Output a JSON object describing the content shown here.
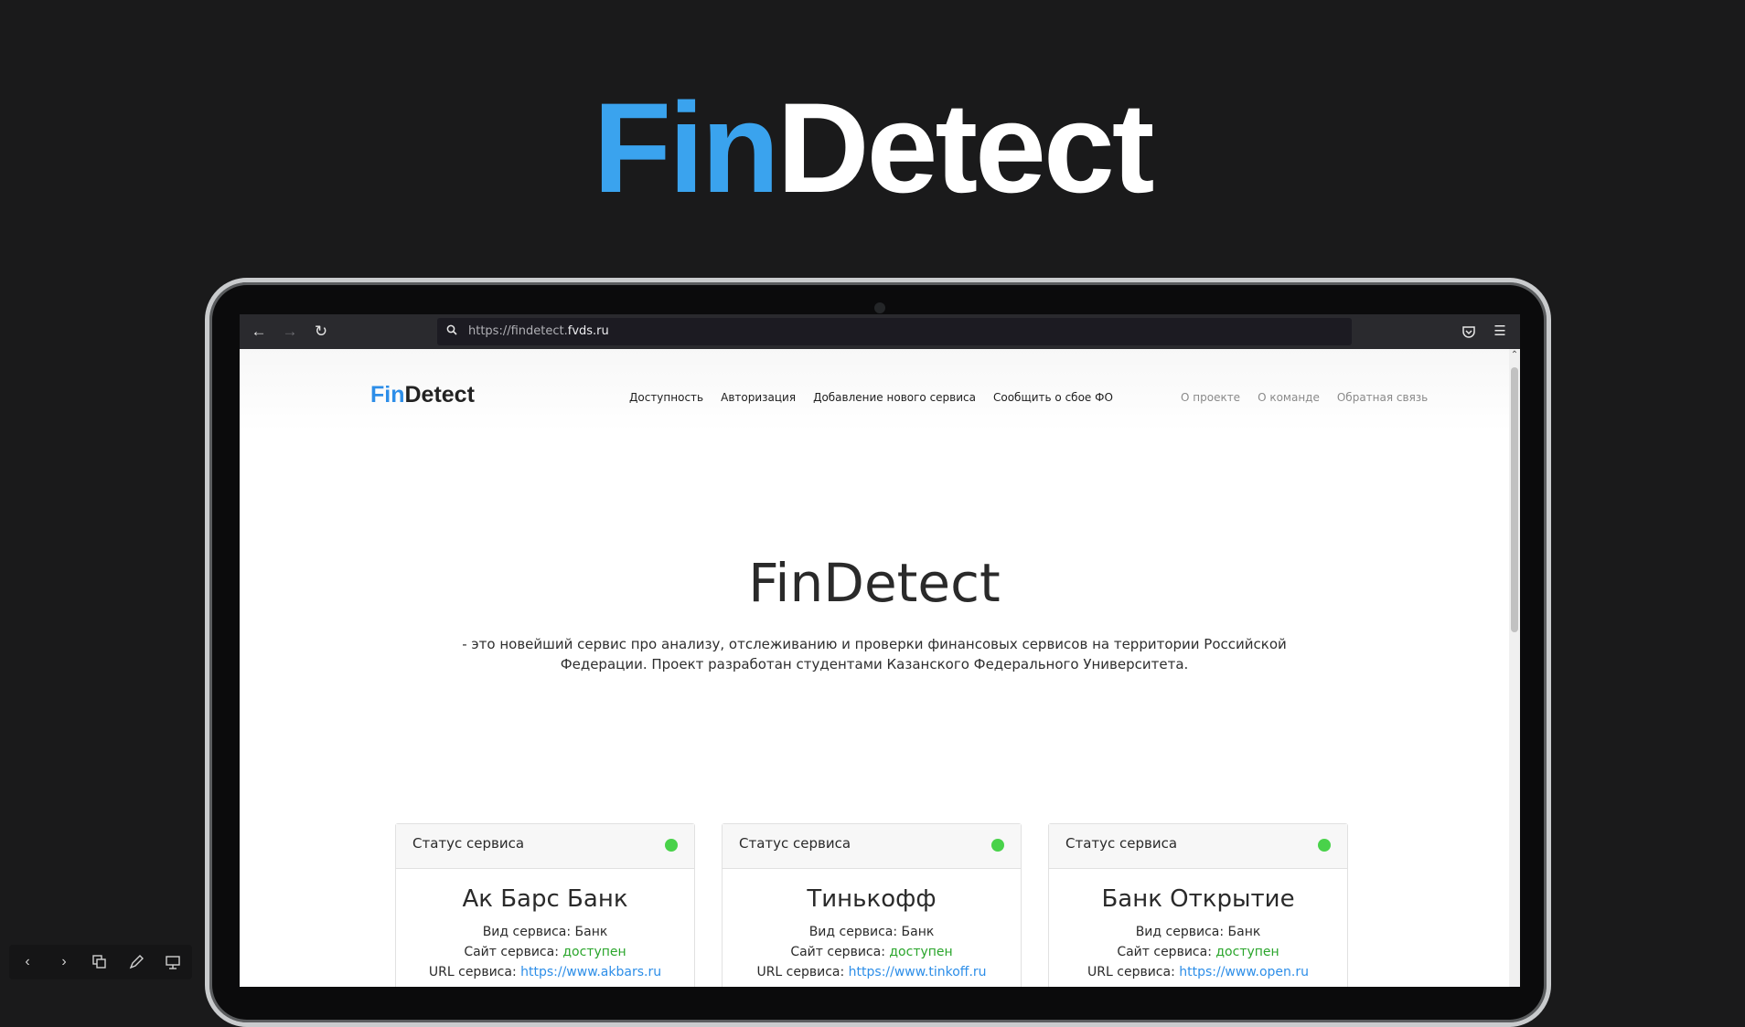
{
  "slide": {
    "title_fin": "Fin",
    "title_detect": "Detect"
  },
  "browser": {
    "url_prefix": "https://findetect.",
    "url_domain": "fvds.ru"
  },
  "site": {
    "logo_fin": "Fin",
    "logo_detect": "Detect",
    "main_nav": [
      "Доступность",
      "Авторизация",
      "Добавление нового сервиса",
      "Сообщить о сбое ФО"
    ],
    "side_nav": [
      "О проекте",
      "О команде",
      "Обратная связь"
    ],
    "hero_title": "FinDetect",
    "hero_description": "- это новейший сервис про анализу, отслеживанию и проверки финансовых сервисов на территории Российской Федерации. Проект разработан студентами Казанского Федерального Университета."
  },
  "cards": [
    {
      "status_label": "Статус сервиса",
      "name": "Ак Барс Банк",
      "type_label": "Вид сервиса:",
      "type_value": "Банк",
      "site_label": "Сайт сервиса:",
      "site_value": "доступен",
      "url_label": "URL сервиса:",
      "url_value": "https://www.akbars.ru"
    },
    {
      "status_label": "Статус сервиса",
      "name": "Тинькофф",
      "type_label": "Вид сервиса:",
      "type_value": "Банк",
      "site_label": "Сайт сервиса:",
      "site_value": "доступен",
      "url_label": "URL сервиса:",
      "url_value": "https://www.tinkoff.ru"
    },
    {
      "status_label": "Статус сервиса",
      "name": "Банк Открытие",
      "type_label": "Вид сервиса:",
      "type_value": "Банк",
      "site_label": "Сайт сервиса:",
      "site_value": "доступен",
      "url_label": "URL сервиса:",
      "url_value": "https://www.open.ru"
    }
  ],
  "colors": {
    "brand_blue": "#3aa3ee",
    "status_ok": "#49d24a",
    "background": "#1a1a1b"
  },
  "icons": {
    "back": "arrow-left-icon",
    "forward": "arrow-right-icon",
    "reload": "reload-icon",
    "search": "search-icon",
    "pocket": "pocket-icon",
    "menu": "hamburger-menu-icon"
  }
}
